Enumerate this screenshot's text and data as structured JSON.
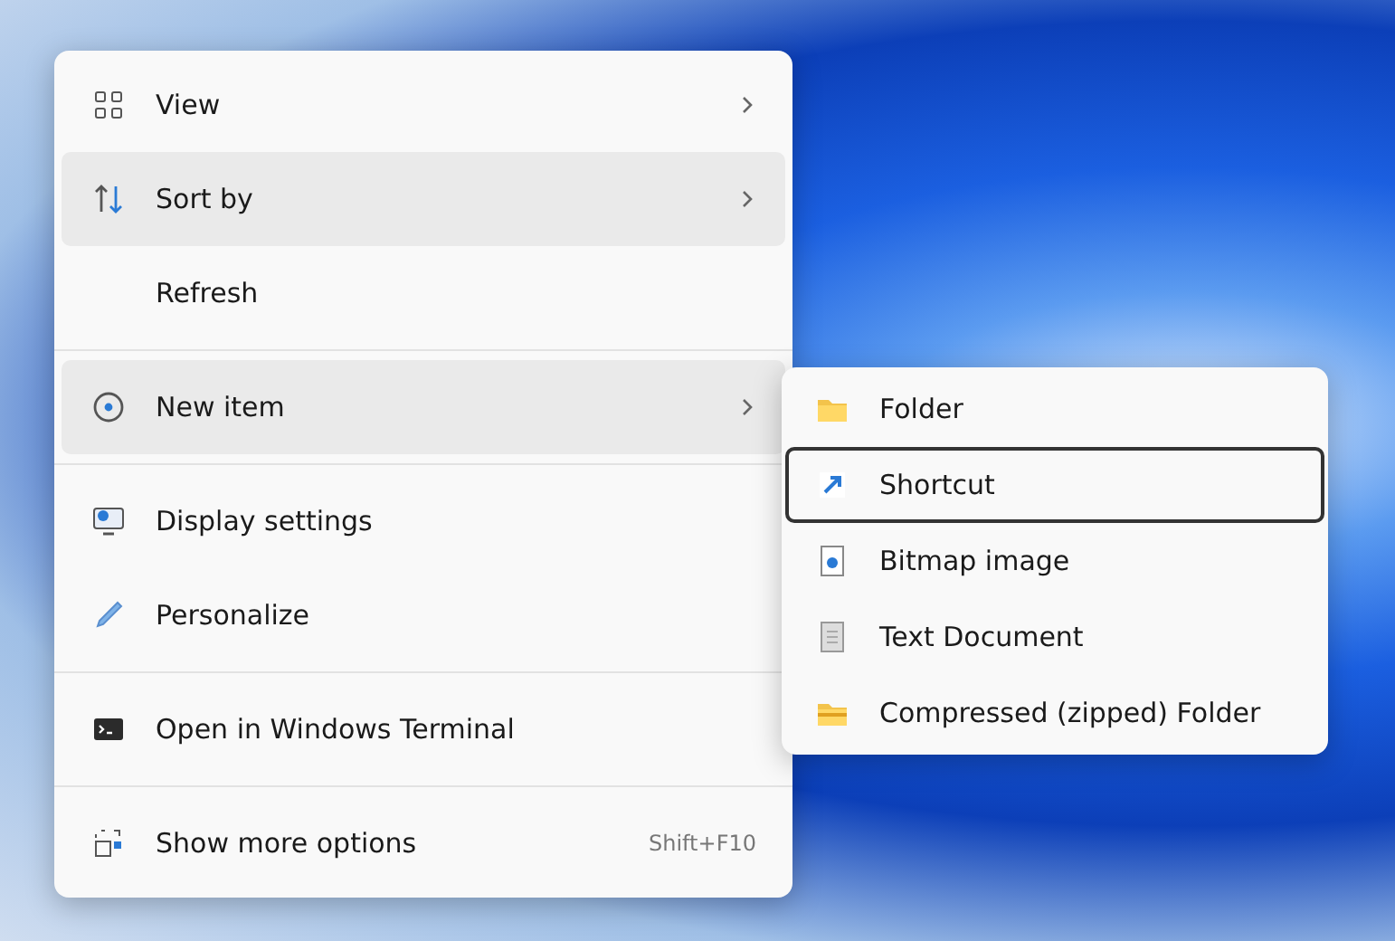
{
  "context_menu": {
    "groups": [
      [
        {
          "label": "View",
          "highlighted": false,
          "submenu": true
        },
        {
          "label": "Sort by",
          "highlighted": true,
          "submenu": true
        },
        {
          "label": "Refresh",
          "highlighted": false,
          "submenu": false
        }
      ],
      [
        {
          "label": "New item",
          "highlighted": true,
          "submenu": true
        }
      ],
      [
        {
          "label": "Display settings",
          "highlighted": false,
          "submenu": false
        },
        {
          "label": "Personalize",
          "highlighted": false,
          "submenu": false
        }
      ],
      [
        {
          "label": "Open in Windows Terminal",
          "highlighted": false,
          "submenu": false
        }
      ],
      [
        {
          "label": "Show more options",
          "highlighted": false,
          "submenu": false,
          "shortcut": "Shift+F10"
        }
      ]
    ]
  },
  "submenu": {
    "items": [
      {
        "label": "Folder",
        "focused": false
      },
      {
        "label": "Shortcut",
        "focused": true
      },
      {
        "label": "Bitmap image",
        "focused": false
      },
      {
        "label": "Text Document",
        "focused": false
      },
      {
        "label": "Compressed (zipped) Folder",
        "focused": false
      }
    ]
  }
}
